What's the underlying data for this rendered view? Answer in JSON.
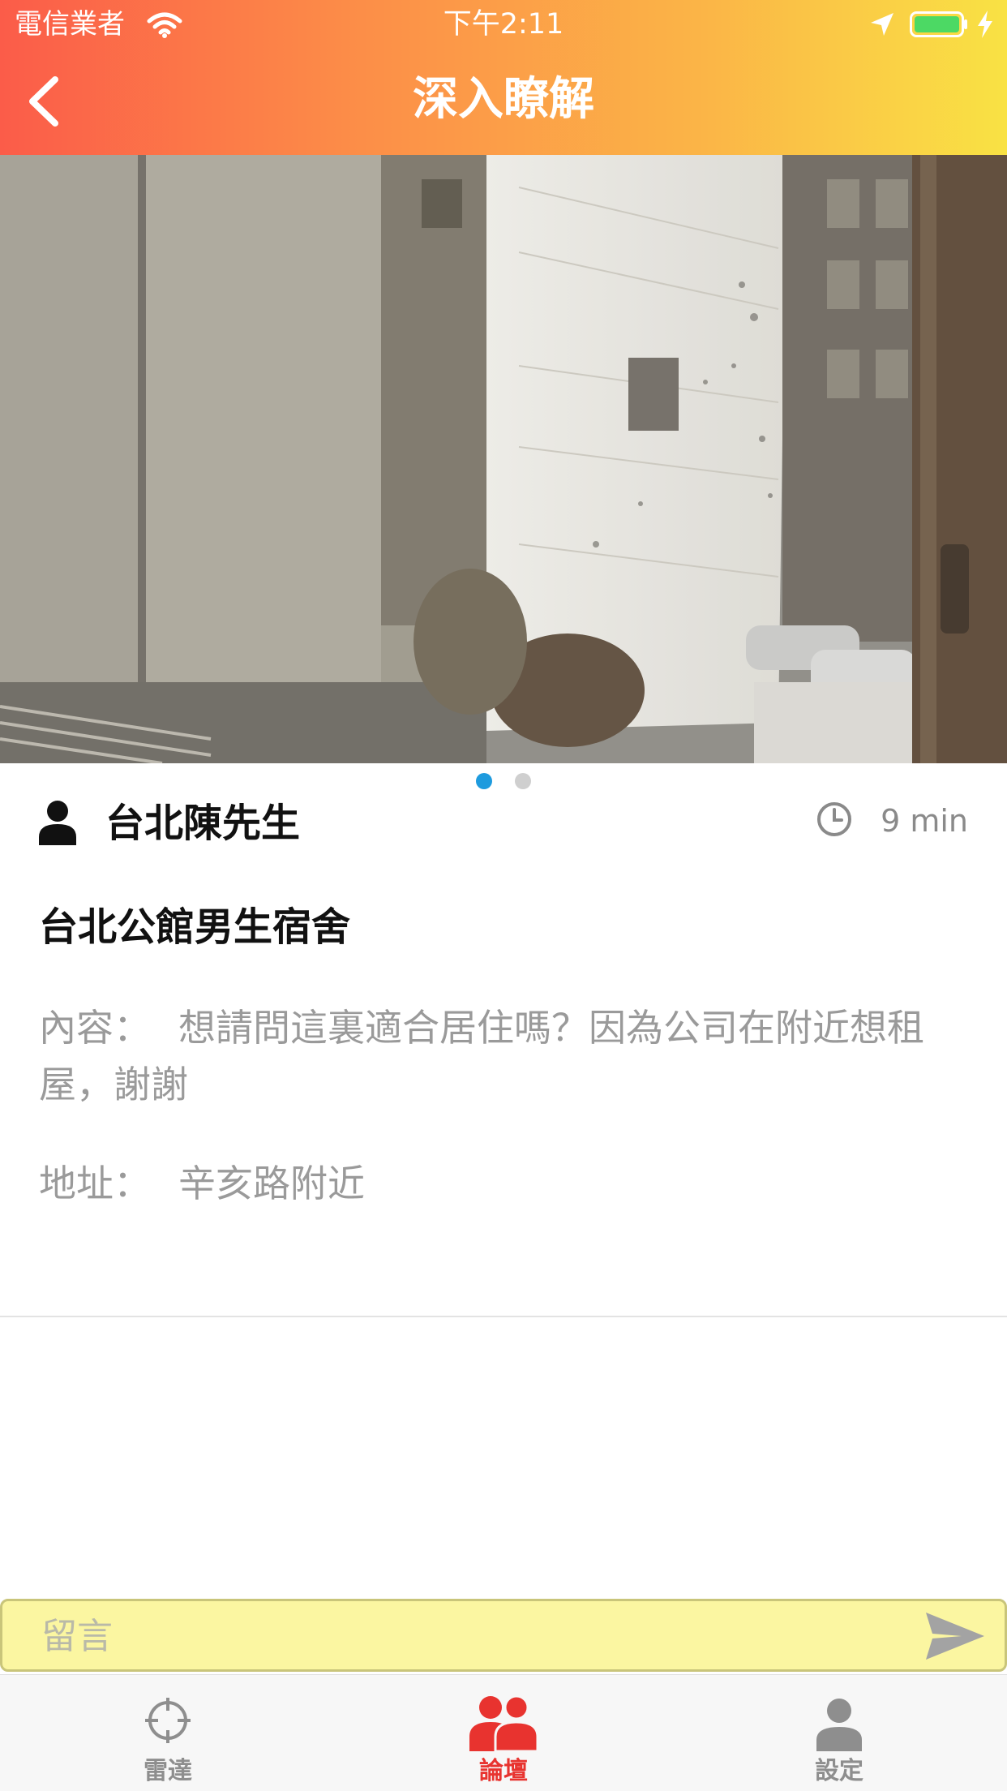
{
  "status_bar": {
    "carrier": "電信業者",
    "time": "下午2:11"
  },
  "nav": {
    "title": "深入瞭解",
    "back_icon": "chevron-left-icon"
  },
  "photo": {
    "page_count": 2,
    "current_page": 1
  },
  "post": {
    "author": "台北陳先生",
    "time_ago": "9 min",
    "title": "台北公館男生宿舍",
    "content_label": "內容：",
    "content_text": "想請問這裏適合居住嗎？因為公司在附近想租屋，謝謝",
    "address_label": "地址：",
    "address_text": "辛亥路附近"
  },
  "comment": {
    "placeholder": "留言",
    "send_icon": "send-icon"
  },
  "tabs": [
    {
      "label": "雷達",
      "icon": "crosshair-icon",
      "active": false
    },
    {
      "label": "論壇",
      "icon": "people-icon",
      "active": true
    },
    {
      "label": "設定",
      "icon": "person-icon",
      "active": false
    }
  ],
  "colors": {
    "header_gradient": [
      "#fb5c49",
      "#fc8d48",
      "#fbb547",
      "#f9e244"
    ],
    "active_tab": "#e8332f",
    "page_dot_active": "#1e9bde",
    "comment_bar_bg": "#fbf6a1"
  }
}
